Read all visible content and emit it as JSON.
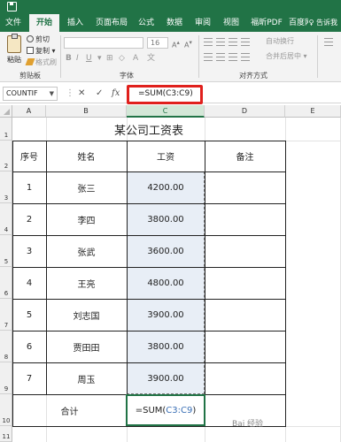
{
  "ribbon": {
    "tabs": [
      "文件",
      "开始",
      "插入",
      "页面布局",
      "公式",
      "数据",
      "审阅",
      "视图",
      "福昕PDF",
      "百度网盘"
    ],
    "active_tab": "开始",
    "help": "♀ 告诉我",
    "paste_label": "粘贴",
    "cut_label": "剪切",
    "copy_label": "复制 ▾",
    "format_painter_label": "格式刷",
    "clipboard_group": "剪贴板",
    "font_group": "字体",
    "align_group": "对齐方式",
    "font_size": "16",
    "wrap_label": "自动换行",
    "merge_label": "合并后居中 ▾"
  },
  "formula_bar": {
    "name_box": "COUNTIF",
    "cancel": "✕",
    "confirm": "✓",
    "fx": "fx",
    "formula_prefix": "=SUM(",
    "formula_ref": "C3:C9",
    "formula_suffix": ")"
  },
  "columns": [
    "A",
    "B",
    "C",
    "D",
    "E"
  ],
  "rows": [
    "1",
    "2",
    "3",
    "4",
    "5",
    "6",
    "7",
    "8",
    "9",
    "10",
    "11"
  ],
  "sheet": {
    "title": "某公司工资表",
    "headers": [
      "序号",
      "姓名",
      "工资",
      "备注"
    ],
    "records": [
      {
        "no": "1",
        "name": "张三",
        "salary": "4200.00"
      },
      {
        "no": "2",
        "name": "李四",
        "salary": "3800.00"
      },
      {
        "no": "3",
        "name": "张武",
        "salary": "3600.00"
      },
      {
        "no": "4",
        "name": "王亮",
        "salary": "4800.00"
      },
      {
        "no": "5",
        "name": "刘志国",
        "salary": "3900.00"
      },
      {
        "no": "6",
        "name": "贾田田",
        "salary": "3800.00"
      },
      {
        "no": "7",
        "name": "周玉",
        "salary": "3900.00"
      }
    ],
    "total_label": "合计",
    "total_prefix": "=SUM(",
    "total_ref": "C3:C9",
    "total_suffix": ")"
  },
  "watermark": "Bai 经验",
  "colors": {
    "accent": "#217346",
    "highlight": "#e0201c",
    "reference": "#3a6fb5"
  }
}
